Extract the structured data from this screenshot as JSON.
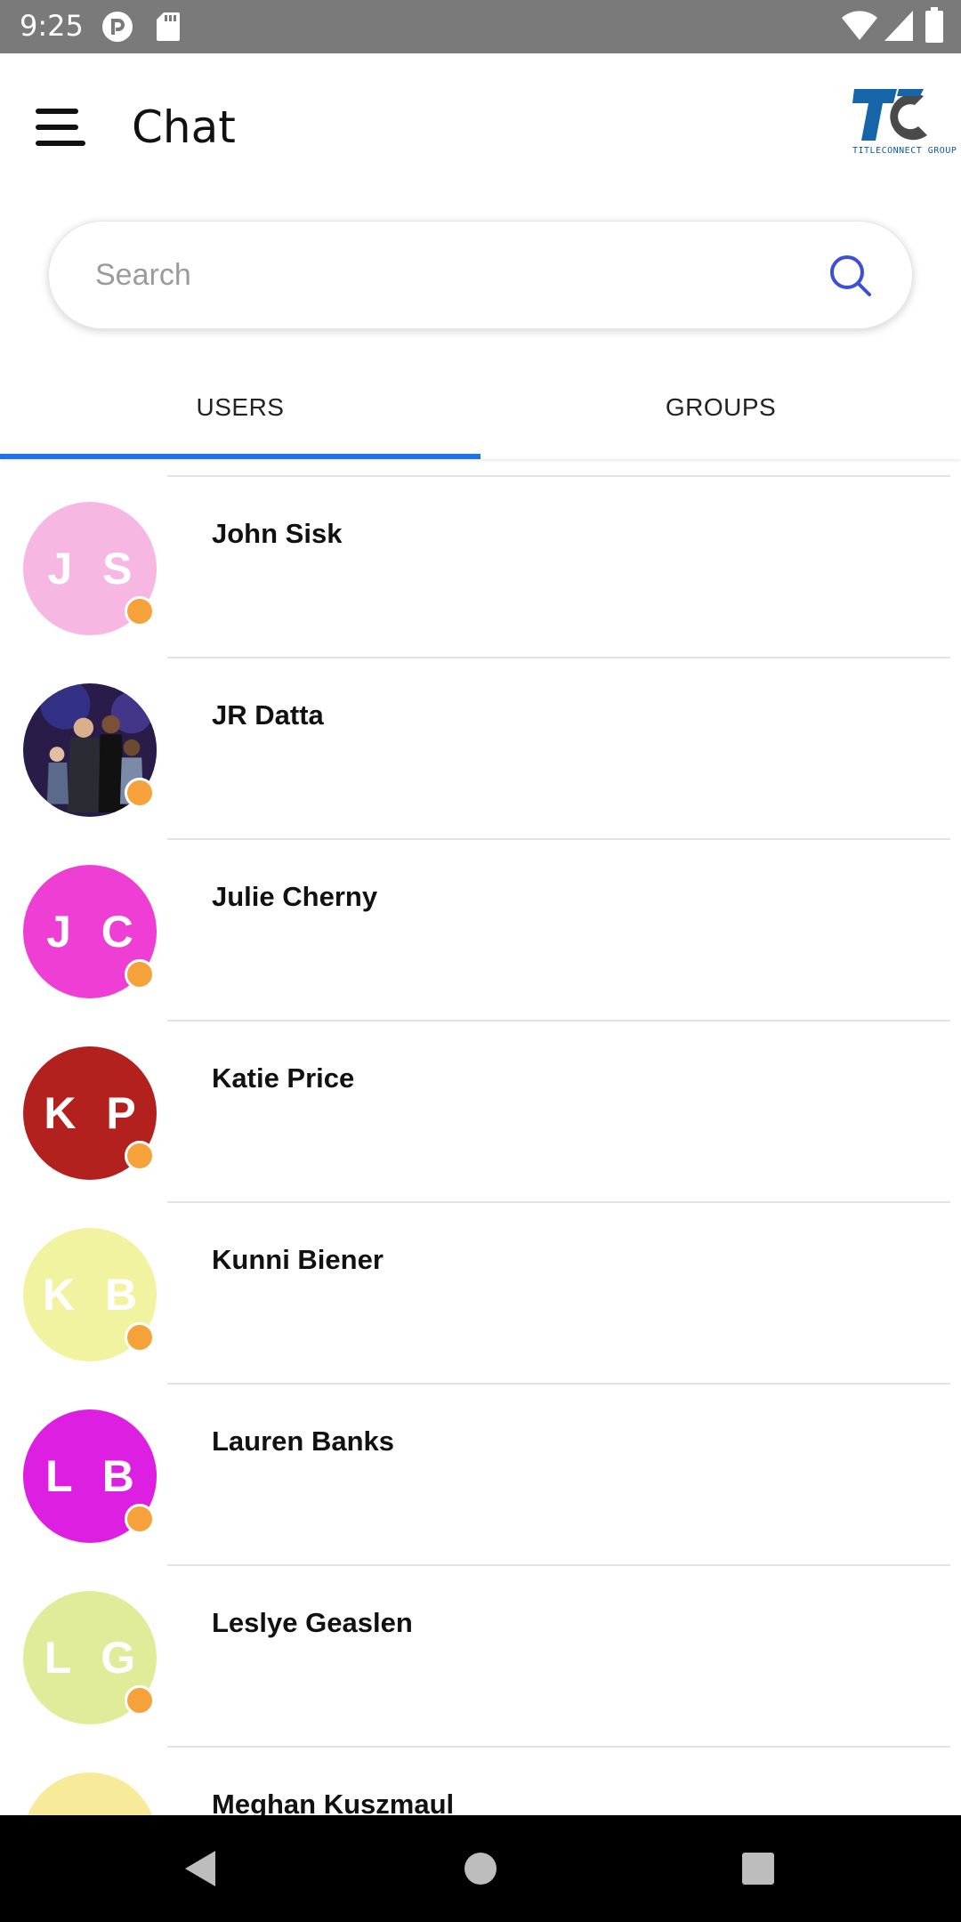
{
  "status_bar": {
    "time": "9:25",
    "icons": [
      "pocketcasts-icon",
      "sd-card-icon",
      "wifi-icon",
      "signal-icon",
      "battery-icon"
    ]
  },
  "header": {
    "title": "Chat",
    "logo_text": "TITLECONNECT GROUP",
    "logo_colors": {
      "primary": "#1565a8",
      "secondary": "#4a4a4a"
    }
  },
  "search": {
    "placeholder": "Search",
    "value": "",
    "icon_color": "#3d4fd6"
  },
  "tabs": [
    {
      "label": "USERS",
      "active": true
    },
    {
      "label": "GROUPS",
      "active": false
    }
  ],
  "accent_color": "#1e73e8",
  "status_dot_color": "#f5a23a",
  "users": [
    {
      "name": "John Sisk",
      "initials": "J S",
      "color": "#f6b8e2",
      "photo": false
    },
    {
      "name": "JR Datta",
      "initials": "",
      "color": "#2a1c48",
      "photo": true
    },
    {
      "name": "Julie Cherny",
      "initials": "J C",
      "color": "#ee3ed4",
      "photo": false
    },
    {
      "name": "Katie Price",
      "initials": "K P",
      "color": "#b3211f",
      "photo": false
    },
    {
      "name": "Kunni Biener",
      "initials": "K B",
      "color": "#f1f3a0",
      "photo": false
    },
    {
      "name": "Lauren Banks",
      "initials": "L B",
      "color": "#dc1fe0",
      "photo": false
    },
    {
      "name": "Leslye Geaslen",
      "initials": "L G",
      "color": "#e1ec9b",
      "photo": false
    },
    {
      "name": "Meghan Kuszmaul",
      "initials": "",
      "color": "#f7eb9a",
      "photo": false
    }
  ],
  "nav": [
    "back-icon",
    "home-icon",
    "recents-icon"
  ]
}
